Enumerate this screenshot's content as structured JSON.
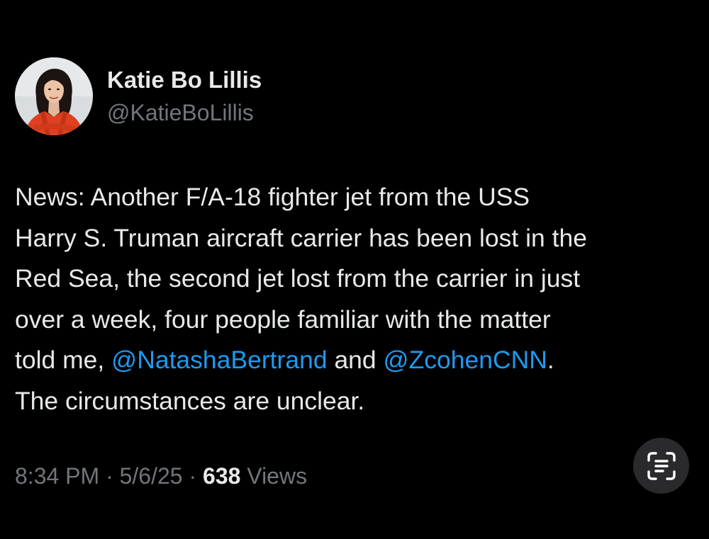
{
  "author": {
    "display_name": "Katie Bo Lillis",
    "handle": "@KatieBoLillis",
    "avatar_icon": "profile-photo"
  },
  "tweet": {
    "lines": [
      [
        {
          "text": "News: Another F/A-18 fighter jet from the USS"
        }
      ],
      [
        {
          "text": "Harry S. Truman aircraft carrier has been lost in the"
        }
      ],
      [
        {
          "text": "Red Sea, the second jet lost from the carrier in just"
        }
      ],
      [
        {
          "text": "over a week, four people familiar with the matter"
        }
      ],
      [
        {
          "text": "told me, "
        },
        {
          "text": "@NatashaBertrand",
          "mention": true
        },
        {
          "text": " and "
        },
        {
          "text": "@ZcohenCNN",
          "mention": true
        },
        {
          "text": "."
        }
      ],
      [
        {
          "text": "The circumstances are unclear."
        }
      ]
    ]
  },
  "meta": {
    "time": "8:34 PM",
    "separator": "·",
    "date": "5/6/25",
    "views_count": "638",
    "views_label": "Views"
  },
  "colors": {
    "background": "#000000",
    "text": "#e7e9ea",
    "secondary": "#71767b",
    "mention": "#1d9bf0",
    "scan_button_bg": "#2a2a2c"
  },
  "icons": {
    "scan_button": "live-text-scan-icon"
  }
}
